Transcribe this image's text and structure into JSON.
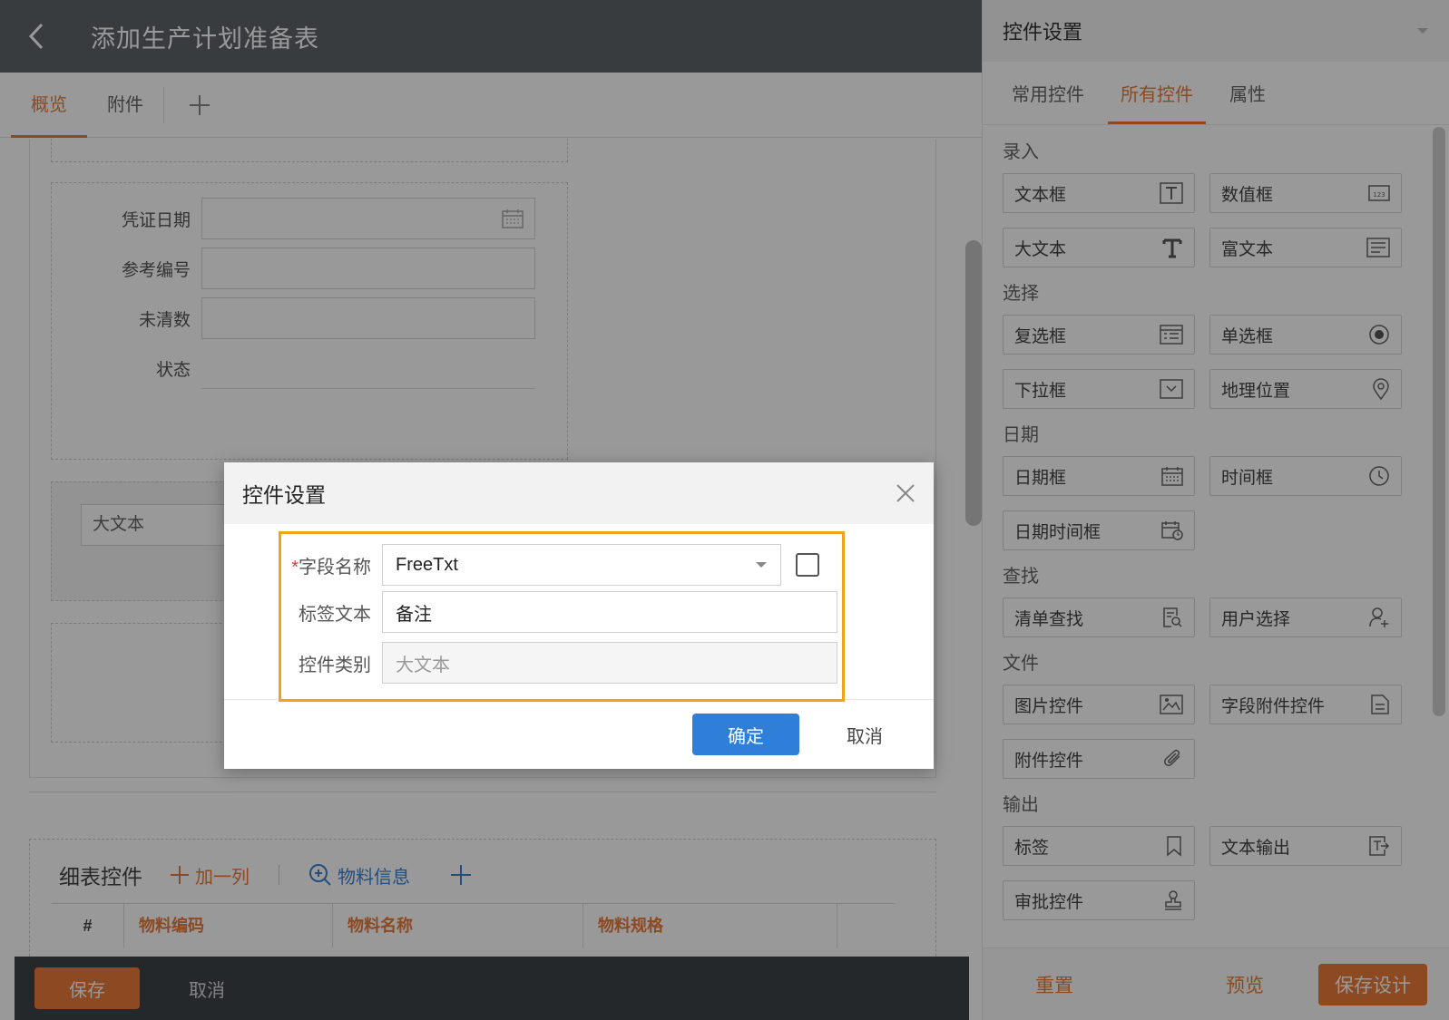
{
  "header": {
    "title": "添加生产计划准备表"
  },
  "tabs": [
    {
      "label": "概览",
      "active": true
    },
    {
      "label": "附件",
      "active": false
    }
  ],
  "form": {
    "voucher_date_label": "凭证日期",
    "ref_no_label": "参考编号",
    "unpaid_label": "未清数",
    "status_label": "状态",
    "bigtext_value": "大文本"
  },
  "detail": {
    "title": "细表控件",
    "add_column": "加一列",
    "material_info": "物料信息",
    "columns": [
      "#",
      "物料编码",
      "物料名称",
      "物料规格"
    ]
  },
  "bottom_bar": {
    "save": "保存",
    "cancel": "取消"
  },
  "right_panel": {
    "title": "控件设置",
    "tabs": [
      {
        "label": "常用控件",
        "active": false
      },
      {
        "label": "所有控件",
        "active": true
      },
      {
        "label": "属性",
        "active": false
      }
    ],
    "groups": [
      {
        "title": "录入",
        "items": [
          {
            "label": "文本框",
            "icon": "text-box-icon"
          },
          {
            "label": "数值框",
            "icon": "number-box-icon"
          },
          {
            "label": "大文本",
            "icon": "big-text-icon"
          },
          {
            "label": "富文本",
            "icon": "rich-text-icon"
          }
        ]
      },
      {
        "title": "选择",
        "items": [
          {
            "label": "复选框",
            "icon": "checkbox-list-icon"
          },
          {
            "label": "单选框",
            "icon": "radio-icon"
          },
          {
            "label": "下拉框",
            "icon": "dropdown-icon"
          },
          {
            "label": "地理位置",
            "icon": "location-pin-icon"
          }
        ]
      },
      {
        "title": "日期",
        "items": [
          {
            "label": "日期框",
            "icon": "calendar-icon"
          },
          {
            "label": "时间框",
            "icon": "clock-icon"
          },
          {
            "label": "日期时间框",
            "icon": "datetime-icon"
          }
        ]
      },
      {
        "title": "查找",
        "items": [
          {
            "label": "清单查找",
            "icon": "list-search-icon"
          },
          {
            "label": "用户选择",
            "icon": "user-add-icon"
          }
        ]
      },
      {
        "title": "文件",
        "items": [
          {
            "label": "图片控件",
            "icon": "image-icon"
          },
          {
            "label": "字段附件控件",
            "icon": "field-attachment-icon"
          },
          {
            "label": "附件控件",
            "icon": "paperclip-icon"
          }
        ]
      },
      {
        "title": "输出",
        "items": [
          {
            "label": "标签",
            "icon": "bookmark-icon"
          },
          {
            "label": "文本输出",
            "icon": "text-output-icon"
          },
          {
            "label": "审批控件",
            "icon": "stamp-icon"
          }
        ]
      }
    ],
    "footer": {
      "reset": "重置",
      "preview": "预览",
      "save_design": "保存设计"
    }
  },
  "modal": {
    "title": "控件设置",
    "field_name_label": "字段名称",
    "field_name_required": "*",
    "field_name_value": "FreeTxt",
    "label_text_label": "标签文本",
    "label_text_value": "备注",
    "control_type_label": "控件类别",
    "control_type_value": "大文本",
    "ok": "确定",
    "cancel": "取消"
  },
  "colors": {
    "accent": "#e97a3a",
    "primary": "#2f7fd8",
    "highlight": "#f3a21b",
    "header": "#5e6469"
  }
}
